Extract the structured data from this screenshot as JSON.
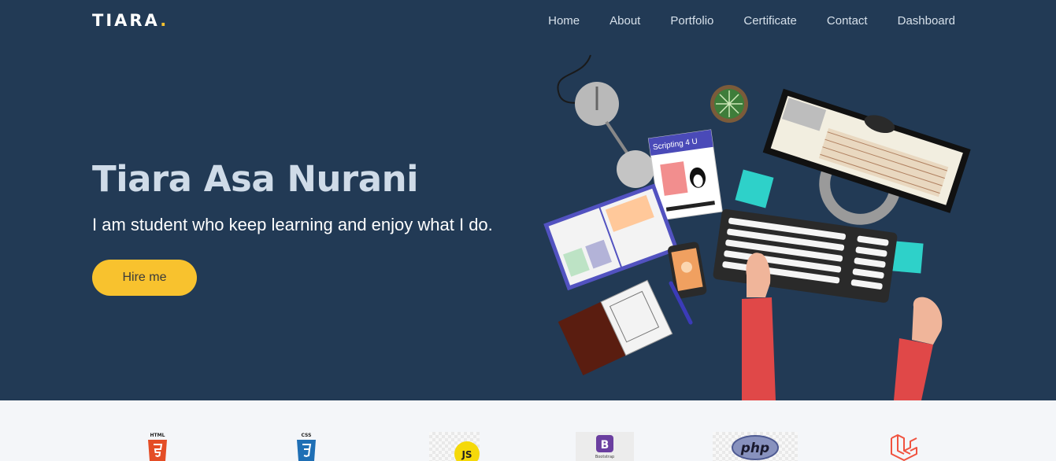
{
  "brand": {
    "name": "TIARA",
    "dot": "."
  },
  "nav": {
    "items": [
      "Home",
      "About",
      "Portfolio",
      "Certificate",
      "Contact",
      "Dashboard"
    ]
  },
  "hero": {
    "title": "Tiara Asa Nurani",
    "subtitle": "I am student who keep learning and enjoy what I do.",
    "cta": "Hire me"
  },
  "illustration": {
    "book_label": "Scripting 4 U"
  },
  "skills": {
    "html_label": "HTML",
    "css_label": "CSS",
    "js_label": "JS",
    "bootstrap_label": "B",
    "bootstrap_sub": "Bootstrap",
    "php_label": "php"
  },
  "colors": {
    "hero_bg": "#223a55",
    "accent": "#f8c22e",
    "section_bg": "#f4f6f9"
  }
}
